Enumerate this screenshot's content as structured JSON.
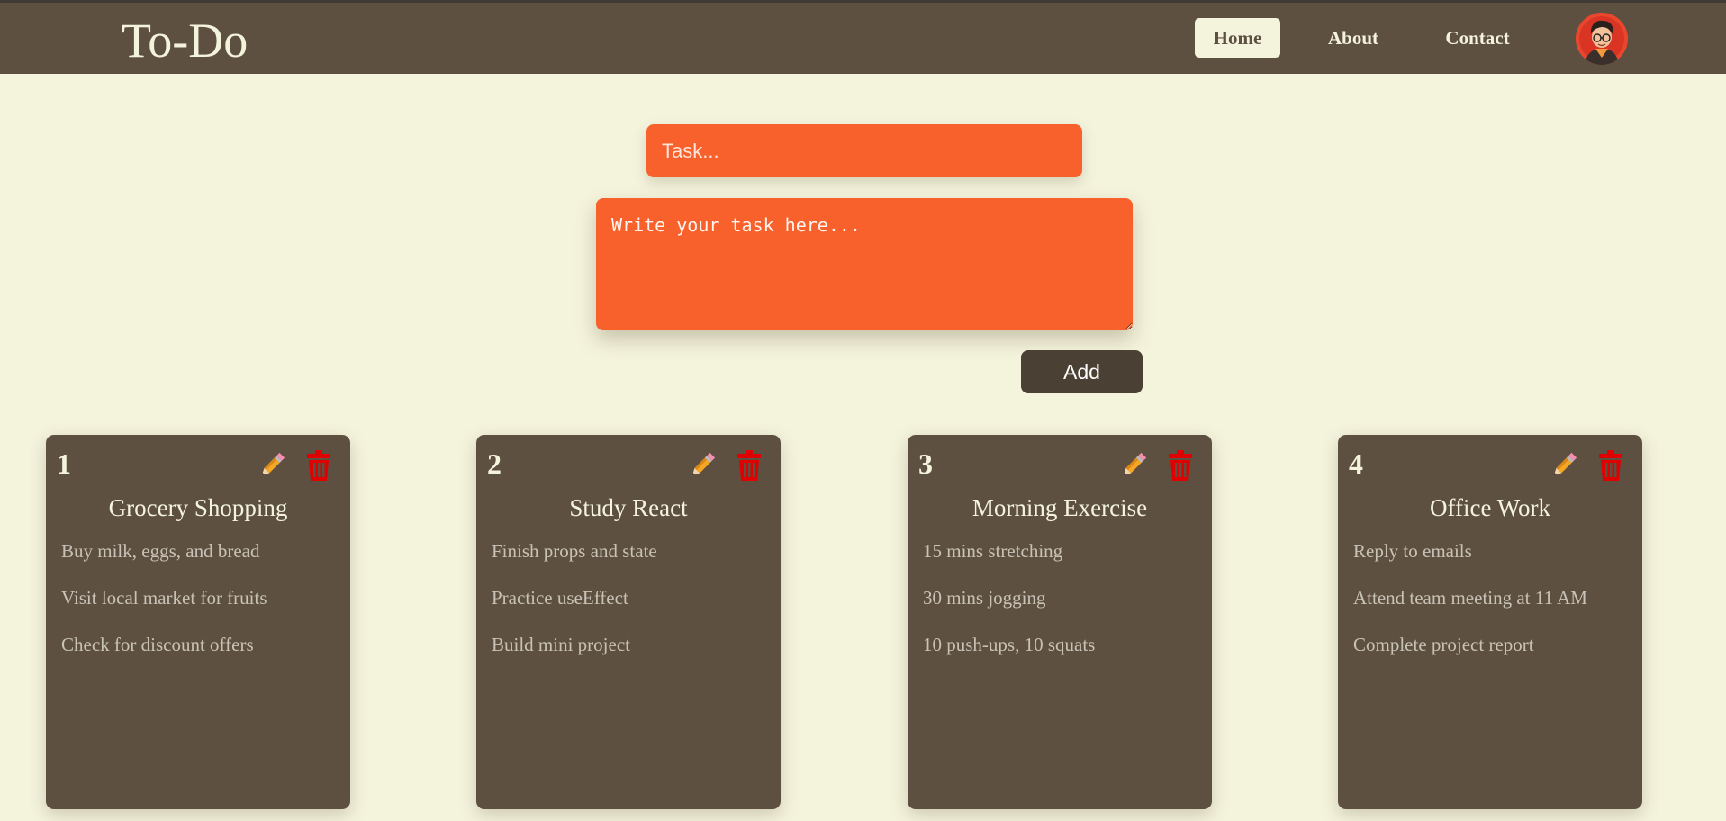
{
  "header": {
    "brand": "To-Do",
    "nav": [
      {
        "label": "Home",
        "active": true
      },
      {
        "label": "About",
        "active": false
      },
      {
        "label": "Contact",
        "active": false
      }
    ],
    "avatar_icon": "user-avatar-icon"
  },
  "form": {
    "title_placeholder": "Task...",
    "title_value": "",
    "body_placeholder": "Write your task here...",
    "body_value": "",
    "add_label": "Add"
  },
  "tasks": [
    {
      "number": "1",
      "title": "Grocery Shopping",
      "items": [
        "Buy milk, eggs, and bread",
        "Visit local market for fruits",
        "Check for discount offers"
      ]
    },
    {
      "number": "2",
      "title": "Study React",
      "items": [
        "Finish props and state",
        "Practice useEffect",
        "Build mini project"
      ]
    },
    {
      "number": "3",
      "title": "Morning Exercise",
      "items": [
        "15 mins stretching",
        "30 mins jogging",
        "10 push-ups, 10 squats"
      ]
    },
    {
      "number": "4",
      "title": "Office Work",
      "items": [
        "Reply to emails",
        "Attend team meeting at 11 AM",
        "Complete project report"
      ]
    }
  ],
  "icons": {
    "edit": "pencil-icon",
    "delete": "trash-icon"
  },
  "colors": {
    "background": "#f4f3dc",
    "navbar": "#5d5040",
    "accent": "#f8612b",
    "button": "#4a4034",
    "delete": "#e00000"
  }
}
